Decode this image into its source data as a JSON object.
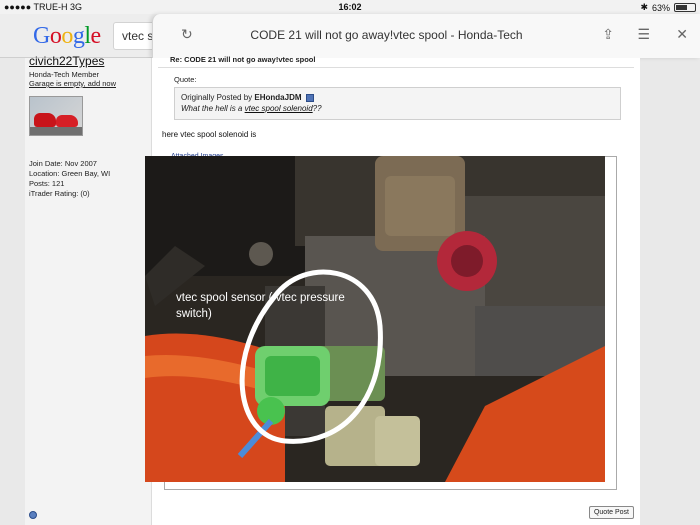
{
  "status_bar": {
    "carrier": "●●●●● TRUE-H  3G",
    "time": "16:02",
    "battery": "63%",
    "battery_level": 0.63
  },
  "browser": {
    "logo": "Google",
    "search_tab_text": "vtec s",
    "tab_title": "CODE 21 will not go away!vtec spool - Honda-Tech"
  },
  "sidebar": {
    "username": "civich22Types",
    "member_title": "Honda-Tech Member",
    "garage_link": "Garage is empty, add now",
    "join_date": "Join Date: Nov 2007",
    "location": "Location: Green Bay, WI",
    "posts": "Posts: 121",
    "itrader": "iTrader Rating: (0)"
  },
  "post": {
    "title": "Re: CODE 21 will not go away!vtec spool",
    "quote_label": "Quote:",
    "quote_originally": "Originally Posted by",
    "quote_author": "EHondaJDM",
    "quote_text_prefix": "What the hell is a",
    "quote_link": "vtec spool solenoid",
    "quote_text_suffix": "??",
    "body": "here vtec spool solenoid is",
    "attachments_legend": "Attached Images",
    "photo_label": "vtec spool sensor ( vtec pressure switch)",
    "quote_post_button": "Quote Post"
  }
}
